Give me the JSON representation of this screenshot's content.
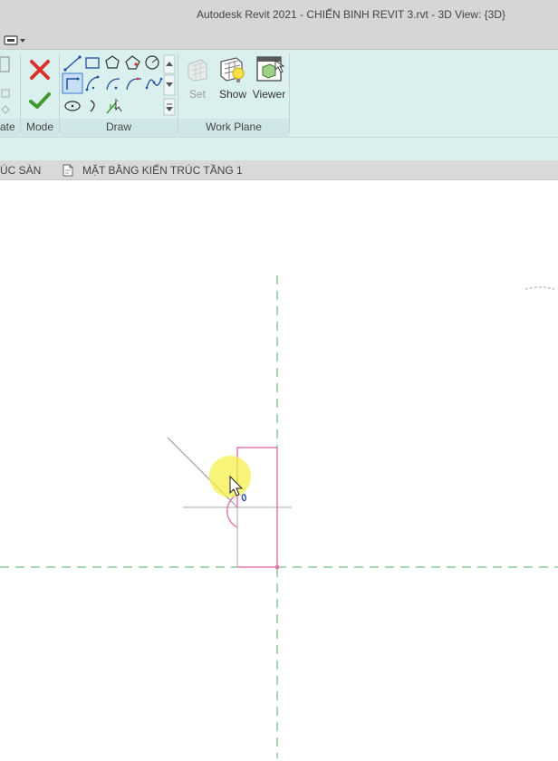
{
  "window": {
    "title": "Autodesk Revit 2021 - CHIẾN BINH REVIT 3.rvt - 3D View: {3D}"
  },
  "ribbon": {
    "panels": {
      "create": {
        "label": "ate"
      },
      "mode": {
        "label": "Mode"
      },
      "draw": {
        "label": "Draw"
      },
      "work_plane": {
        "label": "Work Plane",
        "set_label": "Set",
        "show_label": "Show",
        "viewer_label": "Viewer"
      }
    }
  },
  "view_tabs": [
    {
      "label": "ÚC SÀN"
    },
    {
      "label": "MẶT BẰNG KIẾN TRÚC TẦNG 1"
    }
  ],
  "canvas": {
    "dimension_label": "0",
    "colors": {
      "sketch_line": "#e07ab0",
      "reference_plane": "#4caf6a",
      "guide_line": "#9e9e9e",
      "cursor_highlight": "#f4f04a"
    }
  },
  "colors": {
    "ribbon_bg": "#daf0ef",
    "titlebar_bg": "#d6d6d6",
    "cancel_red": "#d9322c",
    "finish_green": "#3f9a2e"
  }
}
